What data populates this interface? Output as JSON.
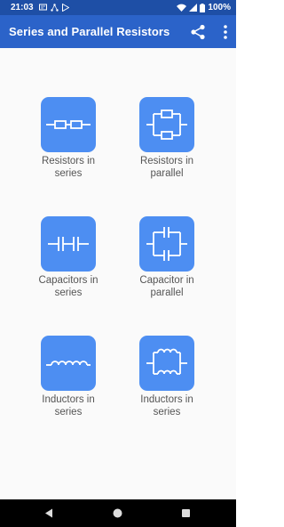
{
  "status_bar": {
    "time": "21:03",
    "battery": "100%",
    "icons": [
      "message-icon",
      "network-icon",
      "play-store-icon",
      "wifi-icon",
      "signal-icon",
      "battery-icon"
    ]
  },
  "app_bar": {
    "title": "Series and Parallel Resistors",
    "actions": [
      "share-icon",
      "more-vert-icon"
    ]
  },
  "grid": {
    "items": [
      {
        "line1": "Resistors in",
        "line2": "series",
        "icon": "resistors-series-icon"
      },
      {
        "line1": "Resistors in",
        "line2": "parallel",
        "icon": "resistors-parallel-icon"
      },
      {
        "line1": "Capacitors in",
        "line2": "series",
        "icon": "capacitors-series-icon"
      },
      {
        "line1": "Capacitor in",
        "line2": "parallel",
        "icon": "capacitor-parallel-icon"
      },
      {
        "line1": "Inductors in",
        "line2": "series",
        "icon": "inductors-series-icon"
      },
      {
        "line1": "Inductors in",
        "line2": "series",
        "icon": "inductors-parallel-icon"
      }
    ]
  },
  "nav_bar": {
    "buttons": [
      "back-icon",
      "home-icon",
      "recents-icon"
    ]
  },
  "colors": {
    "status_bar": "#1e4fa6",
    "app_bar": "#2b63c9",
    "tile": "#4d8ef2",
    "label": "#555555",
    "background": "#fafafa"
  }
}
